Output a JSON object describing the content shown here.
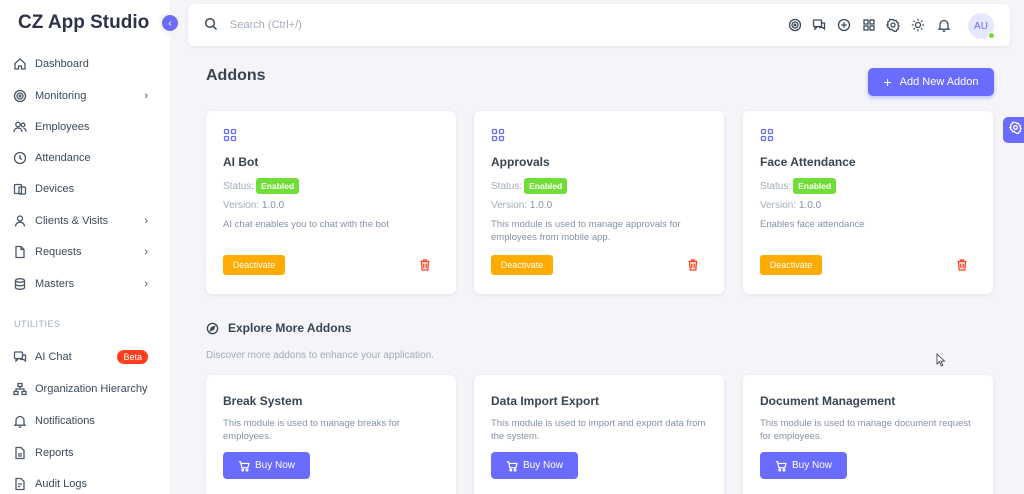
{
  "sidebar": {
    "brand": "CZ App Studio",
    "items": [
      {
        "label": "Dashboard",
        "icon": "home-icon"
      },
      {
        "label": "Monitoring",
        "icon": "target-icon",
        "chevron": true
      },
      {
        "label": "Employees",
        "icon": "users-icon"
      },
      {
        "label": "Attendance",
        "icon": "clock-icon"
      },
      {
        "label": "Devices",
        "icon": "devices-icon"
      },
      {
        "label": "Clients & Visits",
        "icon": "user-icon",
        "chevron": true
      },
      {
        "label": "Requests",
        "icon": "file-icon",
        "chevron": true
      },
      {
        "label": "Masters",
        "icon": "database-icon",
        "chevron": true
      }
    ],
    "section_label": "UTILITIES",
    "utilities": [
      {
        "label": "AI Chat",
        "icon": "chat-icon",
        "badge": "Beta"
      },
      {
        "label": "Organization Hierarchy",
        "icon": "hierarchy-icon"
      },
      {
        "label": "Notifications",
        "icon": "bell-icon"
      },
      {
        "label": "Reports",
        "icon": "report-icon"
      },
      {
        "label": "Audit Logs",
        "icon": "audit-icon"
      }
    ]
  },
  "topbar": {
    "search_placeholder": "Search (Ctrl+/)",
    "icons": [
      "target-icon",
      "chat-icon",
      "plus-circle-icon",
      "apps-icon",
      "settings-icon",
      "sun-icon",
      "bell-icon"
    ],
    "avatar_initials": "AU"
  },
  "page": {
    "title": "Addons",
    "add_button": "Add New Addon"
  },
  "installed": [
    {
      "title": "AI Bot",
      "status_label": "Status:",
      "status": "Enabled",
      "version_label": "Version:",
      "version": "1.0.0",
      "description": "AI chat enables you to chat with the bot",
      "action": "Deactivate"
    },
    {
      "title": "Approvals",
      "status_label": "Status:",
      "status": "Enabled",
      "version_label": "Version:",
      "version": "1.0.0",
      "description": "This module is used to manage approvals for employees from mobile app.",
      "action": "Deactivate"
    },
    {
      "title": "Face Attendance",
      "status_label": "Status:",
      "status": "Enabled",
      "version_label": "Version:",
      "version": "1.0.0",
      "description": "Enables face attendance",
      "action": "Deactivate"
    }
  ],
  "explore": {
    "title": "Explore More Addons",
    "subtitle": "Discover more addons to enhance your application.",
    "items": [
      {
        "title": "Break System",
        "description": "This module is used to manage breaks for employees.",
        "action": "Buy Now"
      },
      {
        "title": "Data Import Export",
        "description": "This module is used to import and export data from the system.",
        "action": "Buy Now"
      },
      {
        "title": "Document Management",
        "description": "This module is used to manage document request for employees.",
        "action": "Buy Now"
      }
    ]
  },
  "colors": {
    "primary": "#696cff",
    "success": "#71dd37",
    "warning": "#ffab00",
    "danger": "#ff3e1d"
  }
}
